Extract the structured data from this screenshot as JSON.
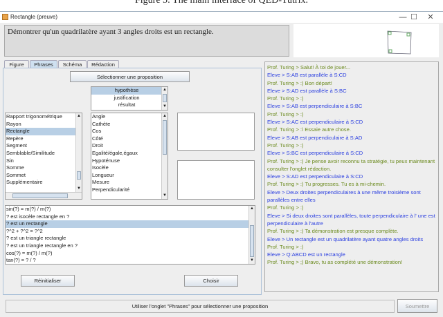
{
  "caption": "Figure 5: The main interface of QED-Tutrix.",
  "window": {
    "title": "Rectangle (preuve)",
    "minimize": "—",
    "maximize": "☐",
    "close": "✕"
  },
  "problem": "Démontrer qu'un quadrilatère ayant 3 angles droits est un rectangle.",
  "tabs": [
    {
      "label": "Figure"
    },
    {
      "label": "Phrases"
    },
    {
      "label": "Schéma"
    },
    {
      "label": "Rédaction"
    }
  ],
  "select_button": "Sélectionner une proposition",
  "categories": [
    "hypothèse",
    "justification",
    "résultat"
  ],
  "concepts": [
    "Rapport trigonométrique",
    "Rayon",
    "Rectangle",
    "Repère",
    "Segment",
    "Semblable/Similitude",
    "Sin",
    "Somme",
    "Sommet",
    "Supplémentaire"
  ],
  "terms": [
    "Angle",
    "Cathète",
    "Cos",
    "Côté",
    "Droit",
    "Egalité/égale,égaux",
    "Hypoténuse",
    "Isocèle",
    "Longueur",
    "Mesure",
    "Perpendicularité"
  ],
  "propositions": [
    "sin(?) = m(?) / m(?)",
    "? est isocèle rectangle en ?",
    "? est un rectangle",
    "?^2 + ?^2 = ?^2",
    "? est un triangle rectangle",
    "? est un triangle rectangle en ?",
    "cos(?) = m(?) / m(?)",
    "tan(?) = ? / ?"
  ],
  "reset_button": "Réinitialiser",
  "choose_button": "Choisir",
  "chat": [
    {
      "who": "prof",
      "text": "Prof. Turing >  Salut! À toi de jouer..."
    },
    {
      "who": "eleve",
      "text": "Eleve >  S:AB est parallèle à S:CD"
    },
    {
      "who": "prof",
      "text": "Prof. Turing >  :)  Bon départ!"
    },
    {
      "who": "eleve",
      "text": "Eleve >  S:AD est parallèle à S:BC"
    },
    {
      "who": "prof",
      "text": "Prof. Turing >  :)"
    },
    {
      "who": "eleve",
      "text": "Eleve >  S:AB est perpendiculaire à S:BC"
    },
    {
      "who": "prof",
      "text": "Prof. Turing >  :)"
    },
    {
      "who": "eleve",
      "text": "Eleve >  S:AC est perpendiculaire à S:CD"
    },
    {
      "who": "prof",
      "text": "Prof. Turing >  :\\  Essaie autre chose."
    },
    {
      "who": "eleve",
      "text": "Eleve >  S:AB est perpendiculaire à S:AD"
    },
    {
      "who": "prof",
      "text": "Prof. Turing >  :)"
    },
    {
      "who": "eleve",
      "text": "Eleve >  S:BC est perpendiculaire à S:CD"
    },
    {
      "who": "prof",
      "text": "Prof. Turing >  :)  Je pense avoir reconnu ta stratégie, tu peux maintenant consulter l'onglet rédaction."
    },
    {
      "who": "eleve",
      "text": "Eleve >  S:AD est perpendiculaire à S:CD"
    },
    {
      "who": "prof",
      "text": "Prof. Turing >  :)  Tu progresses. Tu es à mi-chemin."
    },
    {
      "who": "eleve",
      "text": "Eleve >  Deux droites perpendiculaires à une même troisième sont parallèles entre elles"
    },
    {
      "who": "prof",
      "text": "Prof. Turing >  :)"
    },
    {
      "who": "eleve",
      "text": "Eleve >  Si deux droites sont parallèles, toute perpendiculaire à l' une est perpendiculaire à l'autre"
    },
    {
      "who": "prof",
      "text": "Prof. Turing >  :)  Ta démonstration est presque complète."
    },
    {
      "who": "eleve",
      "text": "Eleve >  Un rectangle est un quadrilatère ayant quatre angles droits"
    },
    {
      "who": "prof",
      "text": "Prof. Turing >  :)"
    },
    {
      "who": "eleve",
      "text": "Eleve >  Q:ABCD est un rectangle"
    },
    {
      "who": "prof",
      "text": "Prof. Turing >  ;)  Bravo, tu as complété une démonstration!"
    }
  ],
  "status": "Utiliser l'onglet \"Phrases\" pour sélectionner une proposition",
  "submit_button": "Soumettre",
  "colors": {
    "prof": "#6b8a1e",
    "eleve": "#2b3fe0",
    "selection": "#b8cfe5"
  }
}
